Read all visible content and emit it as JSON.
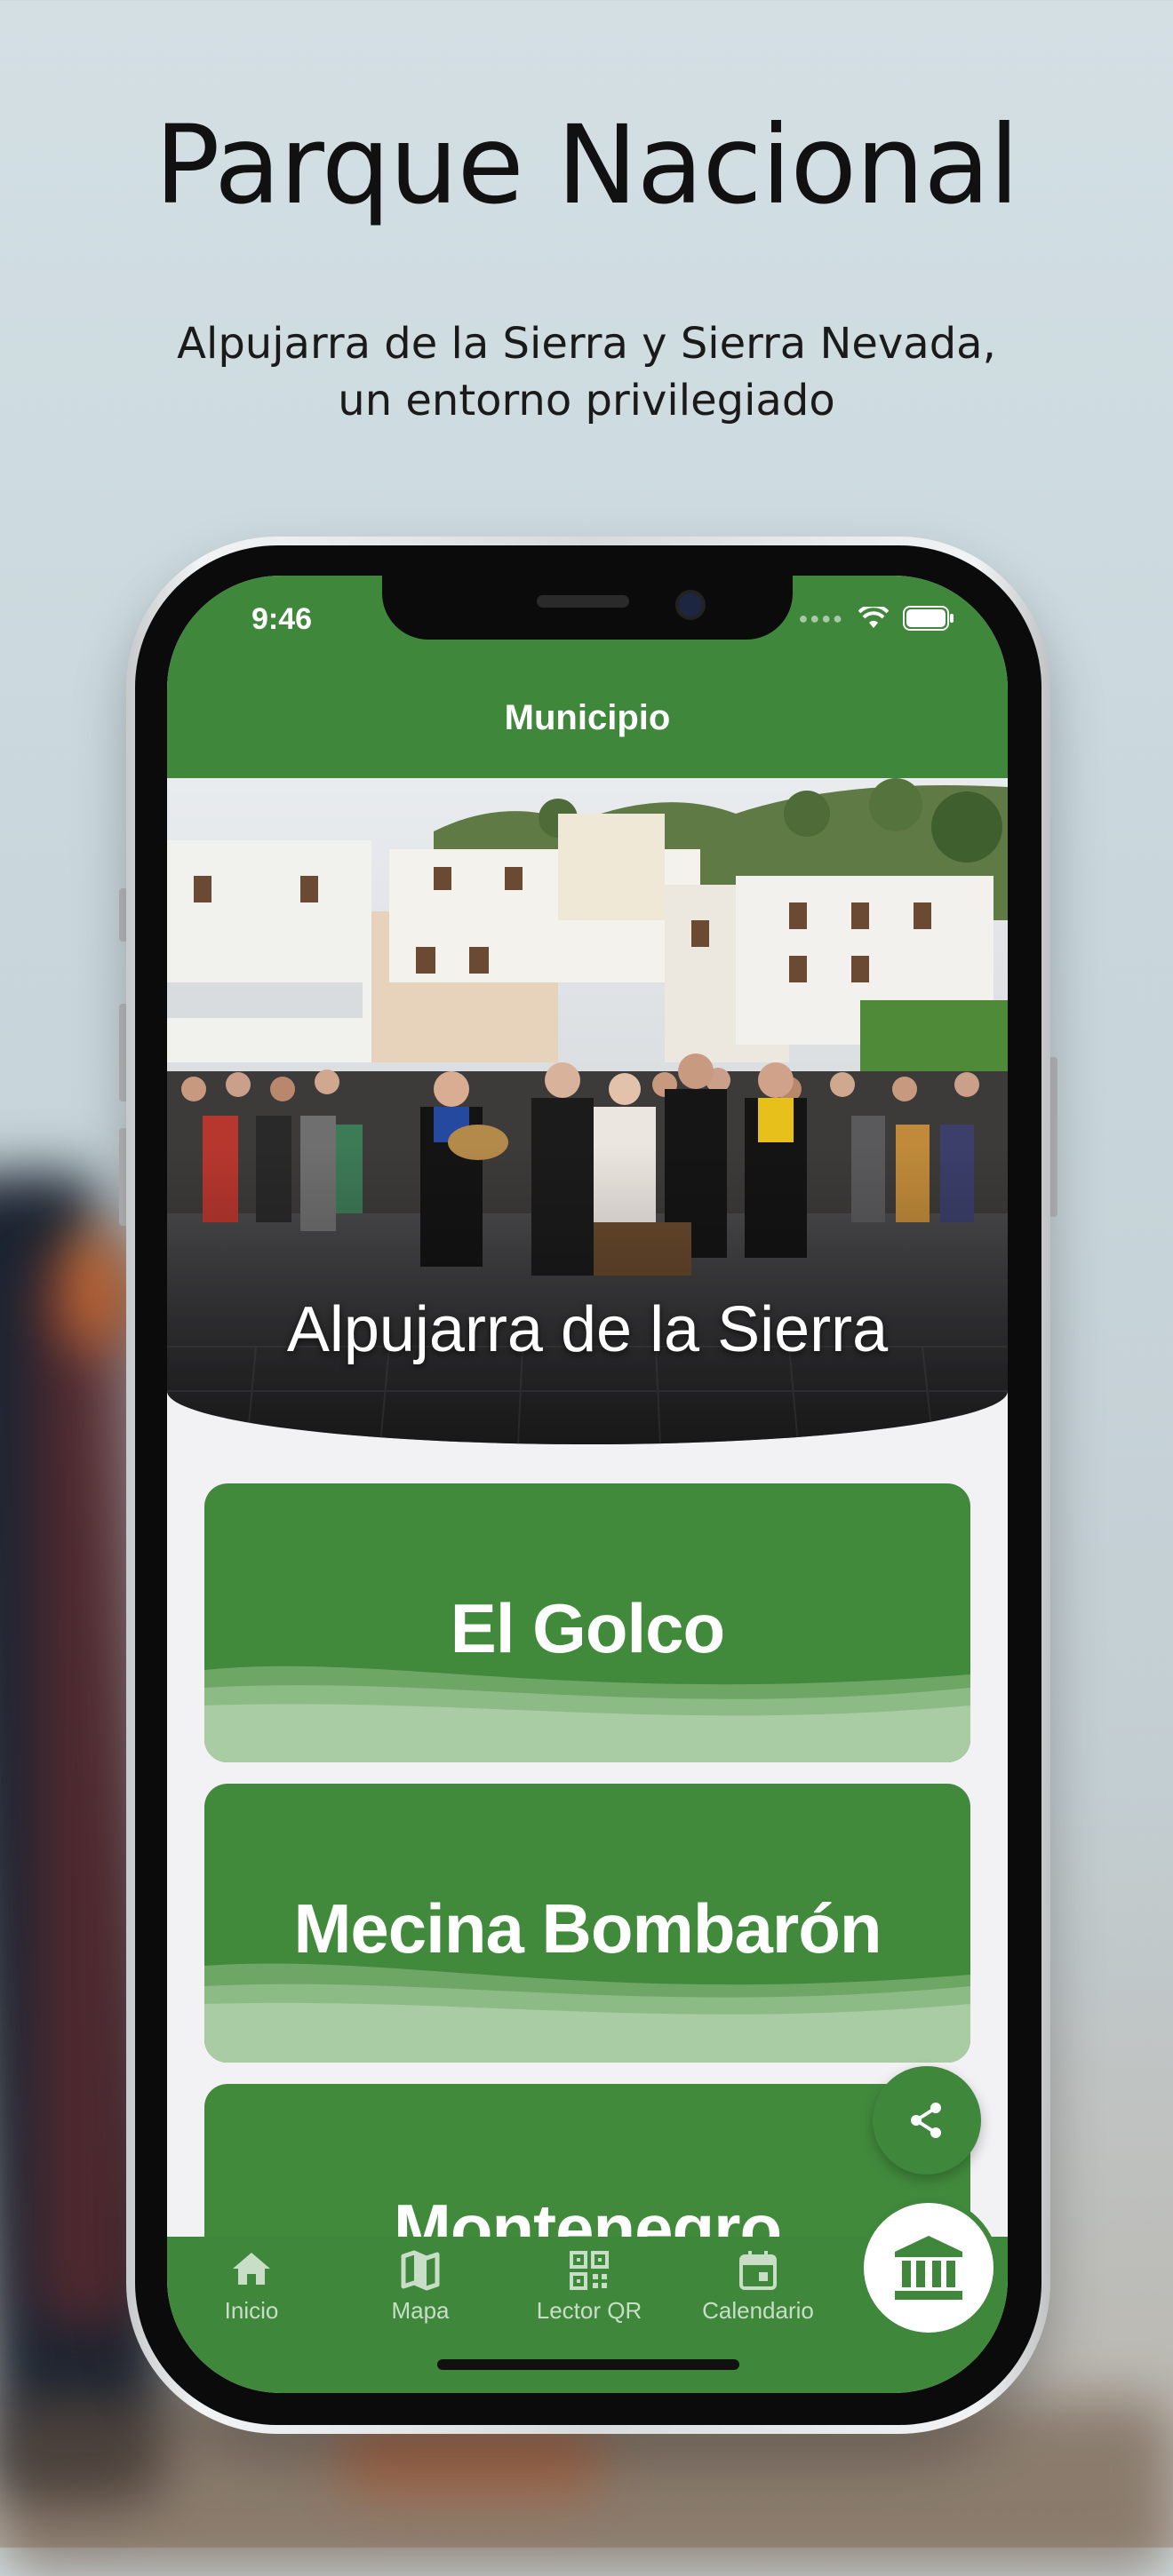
{
  "promo": {
    "headline": "Parque Nacional",
    "subtitle_line1": "Alpujarra de la Sierra y Sierra Nevada,",
    "subtitle_line2": "un entorno privilegiado"
  },
  "status_bar": {
    "time": "9:46"
  },
  "app_bar": {
    "title": "Municipio"
  },
  "hero": {
    "title": "Alpujarra de la Sierra"
  },
  "cards": [
    {
      "label": "El Golco"
    },
    {
      "label": "Mecina Bombarón"
    },
    {
      "label": "Montenegro"
    }
  ],
  "fab": {
    "icon": "share-icon"
  },
  "bottom_nav": {
    "items": [
      {
        "label": "Inicio",
        "icon": "home-icon"
      },
      {
        "label": "Mapa",
        "icon": "map-icon"
      },
      {
        "label": "Lector QR",
        "icon": "qr-code-icon"
      },
      {
        "label": "Calendario",
        "icon": "calendar-icon"
      }
    ],
    "center_icon": "municipality-building-icon"
  },
  "colors": {
    "primary": "#3f873b",
    "card": "#418a3c",
    "card_wave_light": "#a9cca4",
    "nav_label": "#c9dec7",
    "screen_background": "#f2f1f4"
  }
}
